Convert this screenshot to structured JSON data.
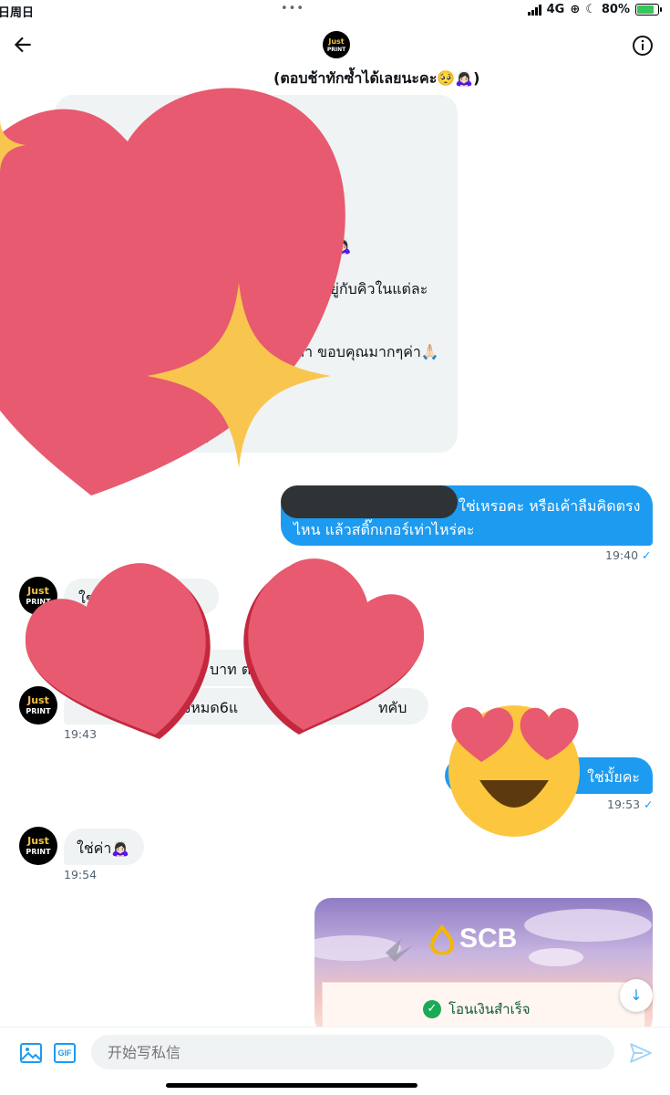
{
  "status_bar": {
    "left_text": "日周日",
    "dots": "•••",
    "network": "4G",
    "battery": "80%",
    "battery_level": 0.8
  },
  "header": {
    "avatar_text_1": "Just",
    "avatar_text_2": "PRINT"
  },
  "conversation": {
    "channel_note": "(ตอบช้าทักซ้ำได้เลยนะคะ🥺🙇🏻‍♀️)",
    "first_message_lines": [
      "ตจริงค่า🙇🏻‍♀️",
      "นอยู่กับคิวในแต่ละ",
      "ยค่า ขอบคุณมากๆค่า🙏🏻",
      "น"
    ],
    "messages": [
      {
        "dir": "out",
        "line1": "ใช่เหรอคะ หรือเค้าลืมคิดตรง",
        "line2": "ไหน แล้วสติ๊กเกอร์เท่าไหร่คะ",
        "time": "19:40",
        "tick": "✓"
      },
      {
        "dir": "in",
        "text": "ใช่ค่า",
        "time": ""
      },
      {
        "dir": "in",
        "text": "บาท ต",
        "time": ""
      },
      {
        "dir": "in",
        "text": "ช้ทั้งหมด6แ",
        "text_end": "ทคับ",
        "time": "19:43"
      },
      {
        "dir": "out",
        "text": "ใช่มั้ยคะ",
        "time": "19:53",
        "tick": "✓"
      },
      {
        "dir": "in",
        "text": "ใช่ค่า🙇🏻‍♀️",
        "time": "19:54"
      }
    ]
  },
  "card": {
    "brand": "SCB",
    "status_text": "โอนเงินสำเร็จ"
  },
  "composer": {
    "placeholder": "开始写私信",
    "gif_label": "GIF"
  },
  "colors": {
    "accent": "#1d9bf0",
    "bubble_in": "#eff3f4",
    "heart": "#e85a6f",
    "sparkle": "#f8c64e"
  },
  "icons": [
    "back-arrow-icon",
    "info-icon",
    "image-icon",
    "gif-icon",
    "send-icon",
    "scroll-down-icon",
    "check-icon"
  ]
}
